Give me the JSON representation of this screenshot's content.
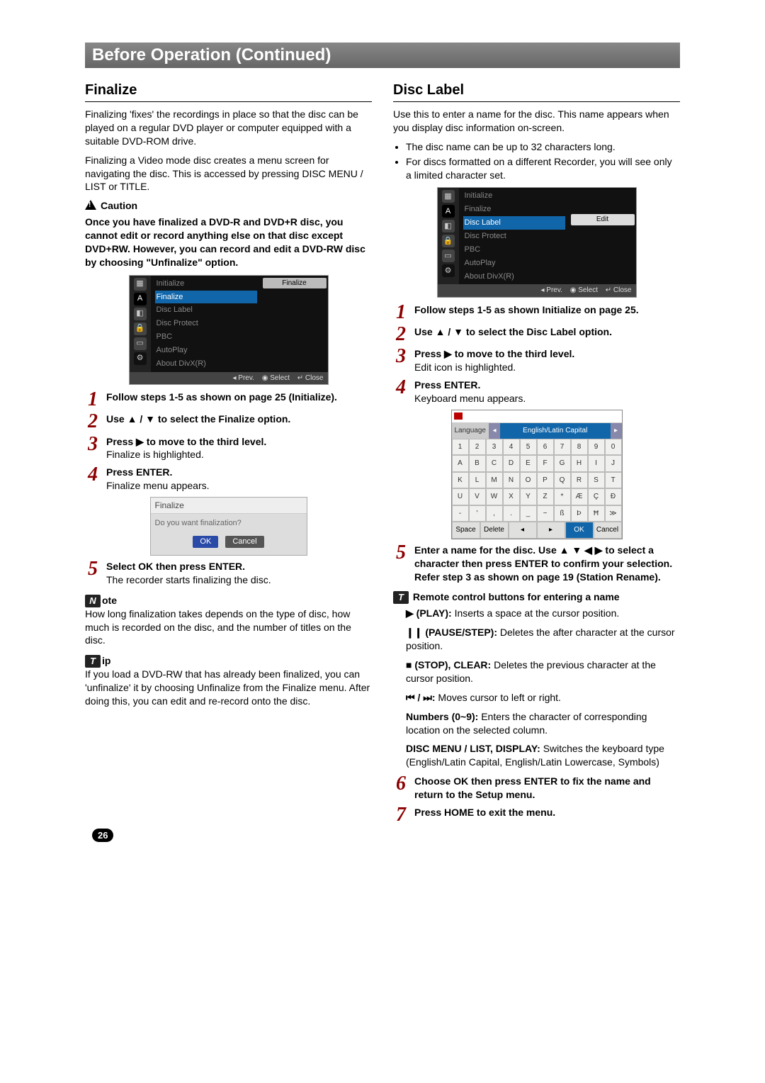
{
  "title_bar": "Before Operation (Continued)",
  "page_number": "26",
  "left": {
    "heading": "Finalize",
    "intro1": "Finalizing 'fixes' the recordings in place so that the disc can be played on a regular DVD player or computer equipped with a suitable DVD-ROM drive.",
    "intro2": "Finalizing a Video mode disc creates a menu screen for navigating the disc. This is accessed by pressing DISC MENU / LIST or TITLE.",
    "caution_label": "Caution",
    "caution_text": "Once you have finalized a DVD-R and DVD+R disc, you cannot edit or record anything else on that disc except DVD+RW. However, you can record and edit a DVD-RW disc by choosing \"Unfinalize\" option.",
    "shot1_menu": [
      "Initialize",
      "Finalize",
      "Disc Label",
      "Disc Protect",
      "PBC",
      "AutoPlay",
      "About DivX(R)"
    ],
    "shot1_selected": "Finalize",
    "shot1_right_pill": "Finalize",
    "shot_footer_prev": "◂ Prev.",
    "shot_footer_select": "◉ Select",
    "shot_footer_close": "↵ Close",
    "step1": "Follow steps 1-5 as shown on page 25 (Initialize).",
    "step2": "Use ▲ / ▼ to select the Finalize option.",
    "step3_b": "Press ▶ to move to the third level.",
    "step3_n": "Finalize is highlighted.",
    "step4_b": "Press ENTER.",
    "step4_n": "Finalize menu appears.",
    "final_title": "Finalize",
    "final_q": "Do you want finalization?",
    "final_ok": "OK",
    "final_cancel": "Cancel",
    "step5_b": "Select OK then press ENTER.",
    "step5_n": "The recorder starts finalizing the disc.",
    "note_label": "ote",
    "note_prefix": "N",
    "note_text": "How long finalization takes depends on the type of disc, how much is recorded on the disc, and the number of titles on the disc.",
    "tip_label": "ip",
    "tip_prefix": "T",
    "tip_text": "If you load a DVD-RW that has already been finalized, you can 'unfinalize' it by choosing Unfinalize from the Finalize menu. After doing this, you can edit and re-record onto the disc."
  },
  "right": {
    "heading": "Disc Label",
    "intro": "Use this to enter a name for the disc. This name appears when you display disc information on-screen.",
    "bul1": "The disc name can be up to 32 characters long.",
    "bul2": "For discs formatted on a different Recorder, you will see only a limited character set.",
    "shot2_menu": [
      "Initialize",
      "Finalize",
      "Disc Label",
      "Disc Protect",
      "PBC",
      "AutoPlay",
      "About DivX(R)"
    ],
    "shot2_selected": "Disc Label",
    "shot2_right_pill": "Edit",
    "step1": "Follow steps 1-5 as shown Initialize on page 25.",
    "step2": "Use ▲ / ▼ to select the Disc Label option.",
    "step3_b": "Press ▶ to move to the third level.",
    "step3_n": "Edit icon is highlighted.",
    "step4_b": "Press ENTER.",
    "step4_n": "Keyboard menu appears.",
    "kb_lang_label": "Language",
    "kb_lang_value": "English/Latin Capital",
    "kb_rows": [
      [
        "1",
        "2",
        "3",
        "4",
        "5",
        "6",
        "7",
        "8",
        "9",
        "0"
      ],
      [
        "A",
        "B",
        "C",
        "D",
        "E",
        "F",
        "G",
        "H",
        "I",
        "J"
      ],
      [
        "K",
        "L",
        "M",
        "N",
        "O",
        "P",
        "Q",
        "R",
        "S",
        "T"
      ],
      [
        "U",
        "V",
        "W",
        "X",
        "Y",
        "Z",
        "*",
        "Æ",
        "Ç",
        "Đ"
      ],
      [
        "-",
        "'",
        ",",
        ".",
        "_",
        "~",
        "ß",
        "Þ",
        "Ħ",
        "≫"
      ]
    ],
    "kb_bottom": [
      "Space",
      "Delete",
      "◂",
      "▸",
      "OK",
      "Cancel"
    ],
    "step5": "Enter a name for the disc. Use ▲ ▼ ◀ ▶ to select a character then press ENTER to confirm your selection. Refer step 3 as shown on page 19 (Station Rename).",
    "tip_remote": "Remote control buttons for entering a name",
    "rc_play_l": "▶ (PLAY):",
    "rc_play_t": " Inserts a space at the cursor position.",
    "rc_pause_l": "❙❙ (PAUSE/STEP):",
    "rc_pause_t": " Deletes the after character at the cursor position.",
    "rc_stop_l": "■ (STOP), CLEAR:",
    "rc_stop_t": " Deletes the previous character at the cursor position.",
    "rc_skip_l": "⏮ / ⏭:",
    "rc_skip_t": " Moves cursor to left or right.",
    "rc_num_l": "Numbers (0~9):",
    "rc_num_t": " Enters the character of corresponding location on the selected column.",
    "rc_disc_l": "DISC MENU / LIST, DISPLAY:",
    "rc_disc_t": " Switches the keyboard type (English/Latin Capital, English/Latin Lowercase, Symbols)",
    "step6": "Choose OK then press ENTER to fix the name and return to the Setup menu.",
    "step7": "Press HOME to exit the menu."
  }
}
